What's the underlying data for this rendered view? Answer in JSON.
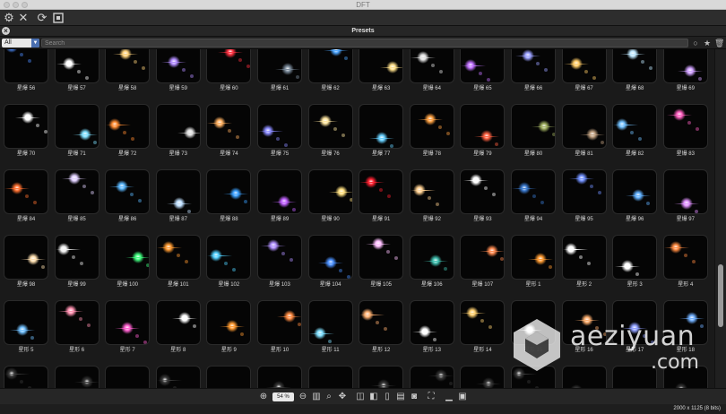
{
  "window": {
    "title": "DFT"
  },
  "toolbar": {
    "icons": [
      "gear-icon",
      "close-x-icon",
      "refresh-icon",
      "fit-frame-icon"
    ]
  },
  "presets": {
    "title": "Presets"
  },
  "filter": {
    "category": "All",
    "search_placeholder": "Search"
  },
  "tiles": [
    {
      "label": "星爆 56",
      "color": "#4d8cff"
    },
    {
      "label": "星爆 57",
      "color": "#ffffff"
    },
    {
      "label": "星爆 58",
      "color": "#ffd27a"
    },
    {
      "label": "星爆 59",
      "color": "#b28cff"
    },
    {
      "label": "星爆 60",
      "color": "#ff3040"
    },
    {
      "label": "星爆 61",
      "color": "#7a8a9a"
    },
    {
      "label": "星爆 62",
      "color": "#4da6ff"
    },
    {
      "label": "星爆 63",
      "color": "#ffe08a"
    },
    {
      "label": "星爆 64",
      "color": "#e0e0e0"
    },
    {
      "label": "星爆 65",
      "color": "#c070ff"
    },
    {
      "label": "星爆 66",
      "color": "#9aa0ff"
    },
    {
      "label": "星爆 67",
      "color": "#ffcc66"
    },
    {
      "label": "星爆 68",
      "color": "#bfe8ff"
    },
    {
      "label": "星爆 69",
      "color": "#d0a0ff"
    },
    {
      "label": "星爆 70",
      "color": "#ffffff"
    },
    {
      "label": "星爆 71",
      "color": "#7fe0ff"
    },
    {
      "label": "星爆 72",
      "color": "#ff8a30"
    },
    {
      "label": "星爆 73",
      "color": "#dddddd"
    },
    {
      "label": "星爆 74",
      "color": "#ffb060"
    },
    {
      "label": "星爆 75",
      "color": "#8a8aff"
    },
    {
      "label": "星爆 76",
      "color": "#ffe6a0"
    },
    {
      "label": "星爆 77",
      "color": "#66d0ff"
    },
    {
      "label": "星爆 78",
      "color": "#ffa040"
    },
    {
      "label": "星爆 79",
      "color": "#ff6040"
    },
    {
      "label": "星爆 80",
      "color": "#a0b060"
    },
    {
      "label": "星爆 81",
      "color": "#c0a080"
    },
    {
      "label": "星爆 82",
      "color": "#70c0ff"
    },
    {
      "label": "星爆 83",
      "color": "#ff60c0"
    },
    {
      "label": "星爆 84",
      "color": "#ff7030"
    },
    {
      "label": "星爆 85",
      "color": "#e0d0ff"
    },
    {
      "label": "星爆 86",
      "color": "#5ab8ff"
    },
    {
      "label": "星爆 87",
      "color": "#c0e0ff"
    },
    {
      "label": "星爆 88",
      "color": "#3aa0ff"
    },
    {
      "label": "星爆 89",
      "color": "#c060ff"
    },
    {
      "label": "星爆 90",
      "color": "#ffe080"
    },
    {
      "label": "星爆 91",
      "color": "#ff2030"
    },
    {
      "label": "星爆 92",
      "color": "#ffd090"
    },
    {
      "label": "星爆 93",
      "color": "#ffffff"
    },
    {
      "label": "星爆 94",
      "color": "#3a7ad0"
    },
    {
      "label": "星爆 95",
      "color": "#7090ff"
    },
    {
      "label": "星爆 96",
      "color": "#60b0ff"
    },
    {
      "label": "星爆 97",
      "color": "#e090ff"
    },
    {
      "label": "星爆 98",
      "color": "#ffe0b0"
    },
    {
      "label": "星爆 99",
      "color": "#f0f0f0"
    },
    {
      "label": "星爆 100",
      "color": "#40ff80"
    },
    {
      "label": "星爆 101",
      "color": "#ff9a30"
    },
    {
      "label": "星爆 102",
      "color": "#50d0ff"
    },
    {
      "label": "星爆 103",
      "color": "#b090ff"
    },
    {
      "label": "星爆 104",
      "color": "#4a90ff"
    },
    {
      "label": "星爆 105",
      "color": "#ffc0ff"
    },
    {
      "label": "星爆 106",
      "color": "#40c0b0"
    },
    {
      "label": "星爆 107",
      "color": "#ff8a50"
    },
    {
      "label": "星形 1",
      "color": "#ff9a30"
    },
    {
      "label": "星形 2",
      "color": "#ffffff"
    },
    {
      "label": "星形 3",
      "color": "#ffffff"
    },
    {
      "label": "星形 4",
      "color": "#ff8a40"
    },
    {
      "label": "星形 5",
      "color": "#70c0ff"
    },
    {
      "label": "星形 6",
      "color": "#ff90b0"
    },
    {
      "label": "星形 7",
      "color": "#ff60d0"
    },
    {
      "label": "星形 8",
      "color": "#ffffff"
    },
    {
      "label": "星形 9",
      "color": "#ff9a30"
    },
    {
      "label": "星形 10",
      "color": "#ff8a40"
    },
    {
      "label": "星形 11",
      "color": "#80e0ff"
    },
    {
      "label": "星形 12",
      "color": "#ffb070"
    },
    {
      "label": "星形 13",
      "color": "#ffffff"
    },
    {
      "label": "星形 14",
      "color": "#ffd070"
    },
    {
      "label": "星形 15",
      "color": "#ffffff"
    },
    {
      "label": "星形 16",
      "color": "#ffb070"
    },
    {
      "label": "星形 17",
      "color": "#90a0ff"
    },
    {
      "label": "星形 18",
      "color": "#70b0ff"
    },
    {
      "label": "",
      "color": "#3a3a3a"
    },
    {
      "label": "",
      "color": "#3a3a3a"
    },
    {
      "label": "",
      "color": "#3a3a3a"
    },
    {
      "label": "",
      "color": "#3a3a3a"
    },
    {
      "label": "",
      "color": "#3a3a3a"
    },
    {
      "label": "",
      "color": "#3a3a3a"
    },
    {
      "label": "",
      "color": "#3a3a3a"
    },
    {
      "label": "",
      "color": "#3a3a3a"
    },
    {
      "label": "",
      "color": "#3a3a3a"
    },
    {
      "label": "",
      "color": "#3a3a3a"
    },
    {
      "label": "",
      "color": "#3a3a3a"
    },
    {
      "label": "",
      "color": "#3a3a3a"
    },
    {
      "label": "",
      "color": "#3a3a3a"
    },
    {
      "label": "",
      "color": "#3a3a3a"
    }
  ],
  "bottombar": {
    "zoom": "54 %"
  },
  "status": {
    "resolution": "2000 x 1125 (8 bits)"
  },
  "watermark": {
    "line1": "aeziyuan",
    "line2": ".com"
  }
}
